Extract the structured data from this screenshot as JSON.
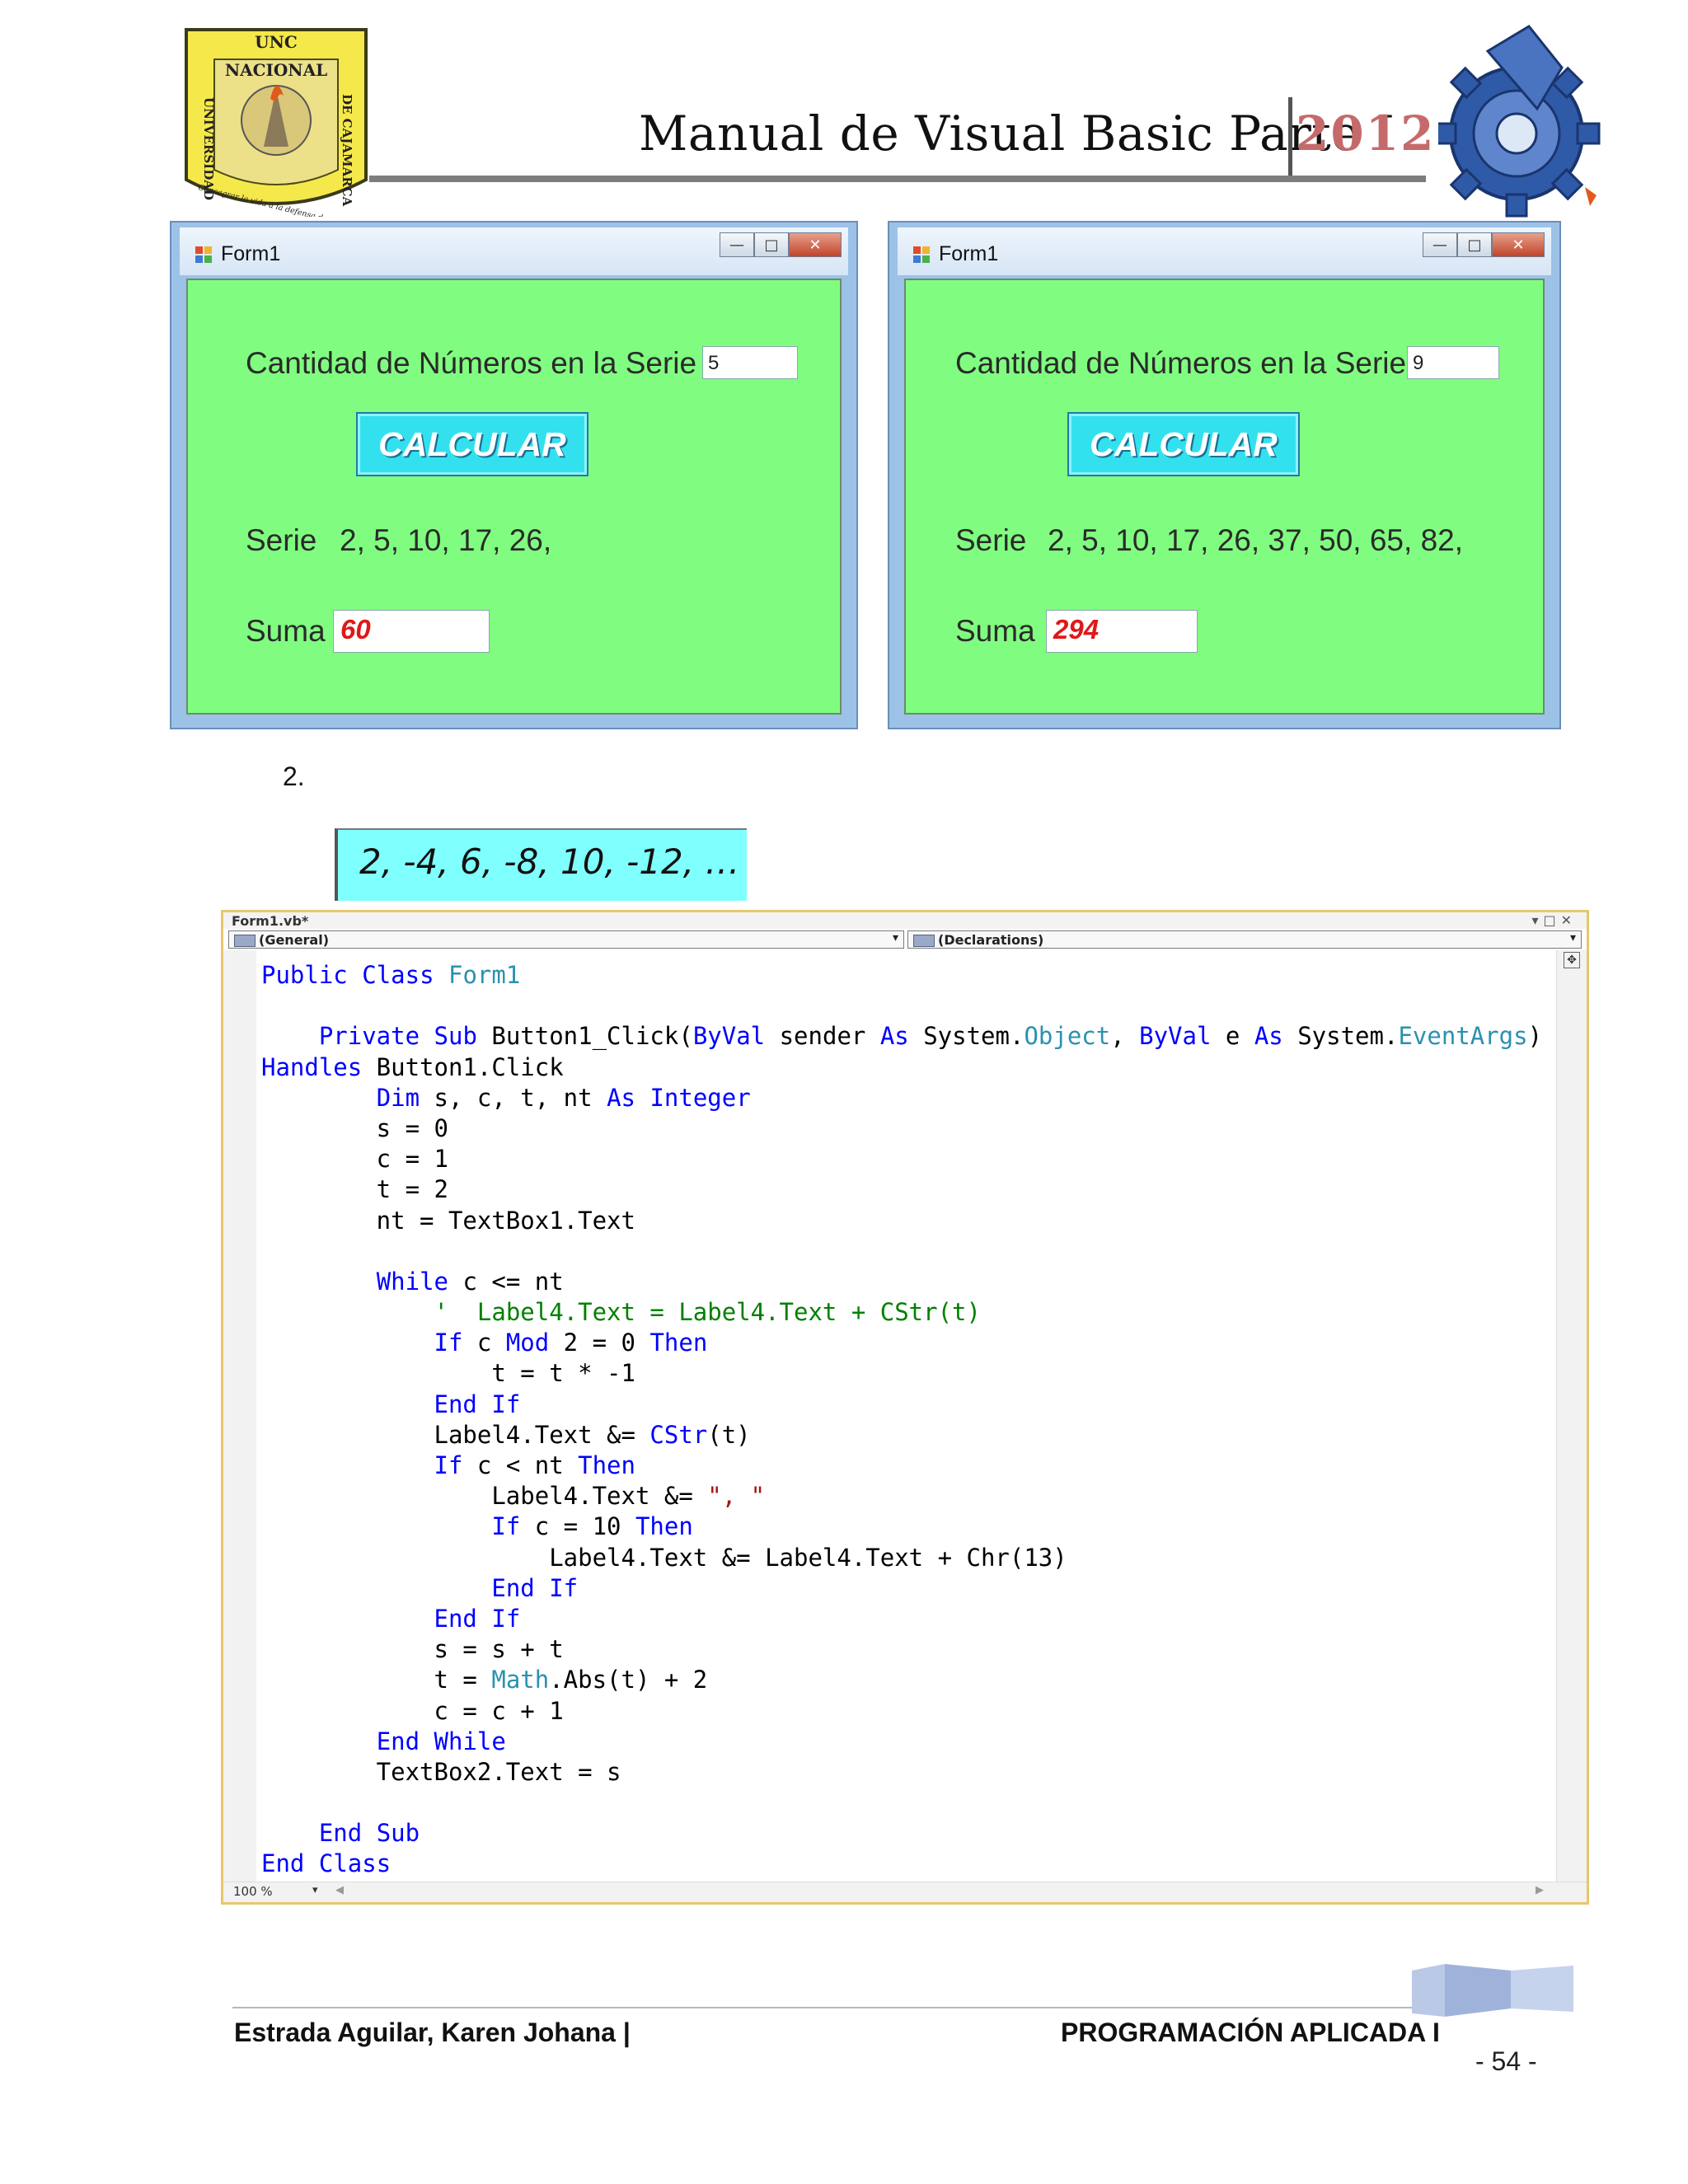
{
  "header": {
    "title": "Manual de Visual Basic Parte I",
    "year": "2012",
    "logo_left": {
      "top": "UNC",
      "name": "NACIONAL",
      "side_left": "UNIVERSIDAD",
      "side_right": "DE CAJAMARCA",
      "motto": "Consagrar la vida a la defensa de la verdad"
    }
  },
  "windows": [
    {
      "title": "Form1",
      "quantity_label": "Cantidad de Números en la Serie",
      "quantity_value": "5",
      "button_label": "CALCULAR",
      "serie_label": "Serie",
      "serie_value": "2, 5, 10, 17, 26,",
      "suma_label": "Suma",
      "suma_value": "60"
    },
    {
      "title": "Form1",
      "quantity_label": "Cantidad de Números en la Serie",
      "quantity_value": "9",
      "button_label": "CALCULAR",
      "serie_label": "Serie",
      "serie_value": "2, 5, 10, 17, 26, 37, 50, 65, 82,",
      "suma_label": "Suma",
      "suma_value": "294"
    }
  ],
  "exercise": {
    "number": "2.",
    "series": "2, -4, 6, -8, 10, -12, …"
  },
  "editor": {
    "tab": "Form1.vb*",
    "combo_left": "(General)",
    "combo_right": "(Declarations)",
    "zoom": "100 %",
    "code_lines": [
      "Public Class Form1",
      "",
      "    Private Sub Button1_Click(ByVal sender As System.Object, ByVal e As System.EventArgs)",
      "Handles Button1.Click",
      "        Dim s, c, t, nt As Integer",
      "        s = 0",
      "        c = 1",
      "        t = 2",
      "        nt = TextBox1.Text",
      "",
      "        While c <= nt",
      "            '  Label4.Text = Label4.Text + CStr(t)",
      "            If c Mod 2 = 0 Then",
      "                t = t * -1",
      "            End If",
      "            Label4.Text &= CStr(t)",
      "            If c < nt Then",
      "                Label4.Text &= \", \"",
      "                If c = 10 Then",
      "                    Label4.Text &= Label4.Text + Chr(13)",
      "                End If",
      "            End If",
      "            s = s + t",
      "            t = Math.Abs(t) + 2",
      "            c = c + 1",
      "        End While",
      "        TextBox2.Text = s",
      "",
      "    End Sub",
      "End Class"
    ]
  },
  "footer": {
    "author": "Estrada Aguilar, Karen Johana |",
    "course": "PROGRAMACIÓN APLICADA I",
    "page": "- 54 -"
  },
  "colors": {
    "form_background": "#80fd80",
    "button_background": "#33e1ee",
    "sum_text": "#e01818",
    "series_box": "#80ffff",
    "year": "#c56a6a",
    "keyword": "#0000ff",
    "type": "#2b91af",
    "comment": "#008000",
    "string": "#a31515"
  }
}
